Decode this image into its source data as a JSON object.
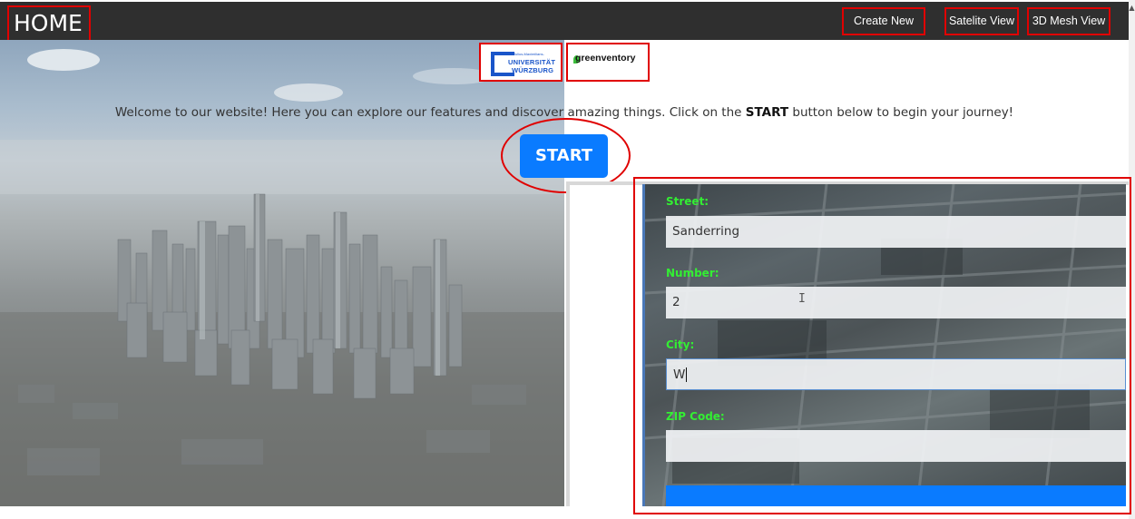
{
  "nav": {
    "home_label": "HOME",
    "buttons": [
      "Create New",
      "Satelite View",
      "3D Mesh View"
    ]
  },
  "logos": {
    "university_small": "Julius-Maximilians-",
    "university_line1": "UNIVERSITÄT",
    "university_line2": "WÜRZBURG",
    "partner": "greenventory"
  },
  "welcome": {
    "before": "Welcome to our website! Here you can explore our features and discover amazing things. Click on the ",
    "bold": "START",
    "after": " button below to begin your journey!"
  },
  "start_button": "START",
  "form": {
    "fields": [
      {
        "label": "Street:",
        "value": "Sanderring"
      },
      {
        "label": "Number:",
        "value": "2"
      },
      {
        "label": "City:",
        "value": "W"
      },
      {
        "label": "ZIP Code:",
        "value": ""
      }
    ]
  },
  "colors": {
    "nav_bg": "#2f2f2f",
    "accent_blue": "#0a7bff",
    "highlight_red": "#e00000",
    "label_green": "#33ee33"
  }
}
